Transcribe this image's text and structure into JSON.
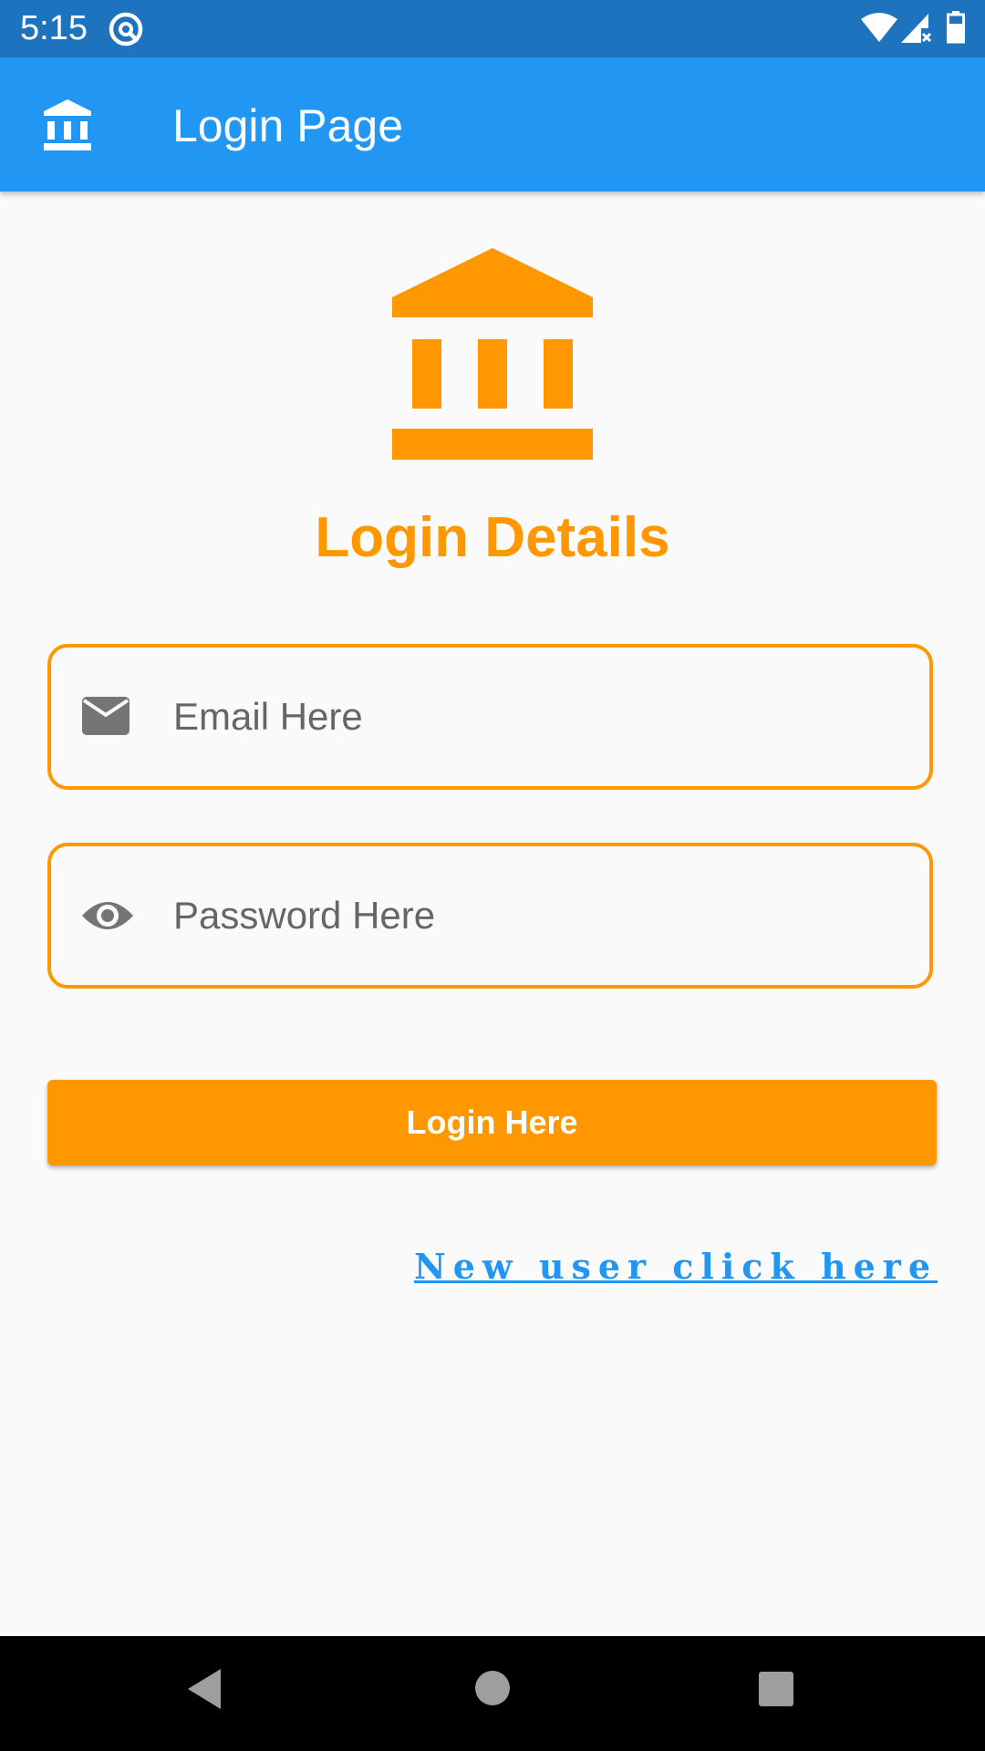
{
  "status_bar": {
    "time": "5:15",
    "app_icon": "app-notification-icon",
    "wifi_icon": "wifi-icon",
    "signal_icon": "signal-no-data-icon",
    "battery_icon": "battery-icon"
  },
  "app_bar": {
    "icon": "bank-icon",
    "title": "Login Page",
    "color": "#2196f3"
  },
  "main": {
    "hero_icon": "bank-icon",
    "heading": "Login Details",
    "accent_color": "#ff9800",
    "email_field": {
      "icon": "mail-icon",
      "placeholder": "Email Here",
      "value": ""
    },
    "password_field": {
      "icon": "eye-icon",
      "placeholder": "Password Here",
      "value": ""
    },
    "login_button_label": "Login Here",
    "new_user_link": "New user click here",
    "link_color": "#2196f3"
  },
  "nav_bar": {
    "back_icon": "back-triangle-icon",
    "home_icon": "home-circle-icon",
    "recent_icon": "recent-square-icon"
  }
}
